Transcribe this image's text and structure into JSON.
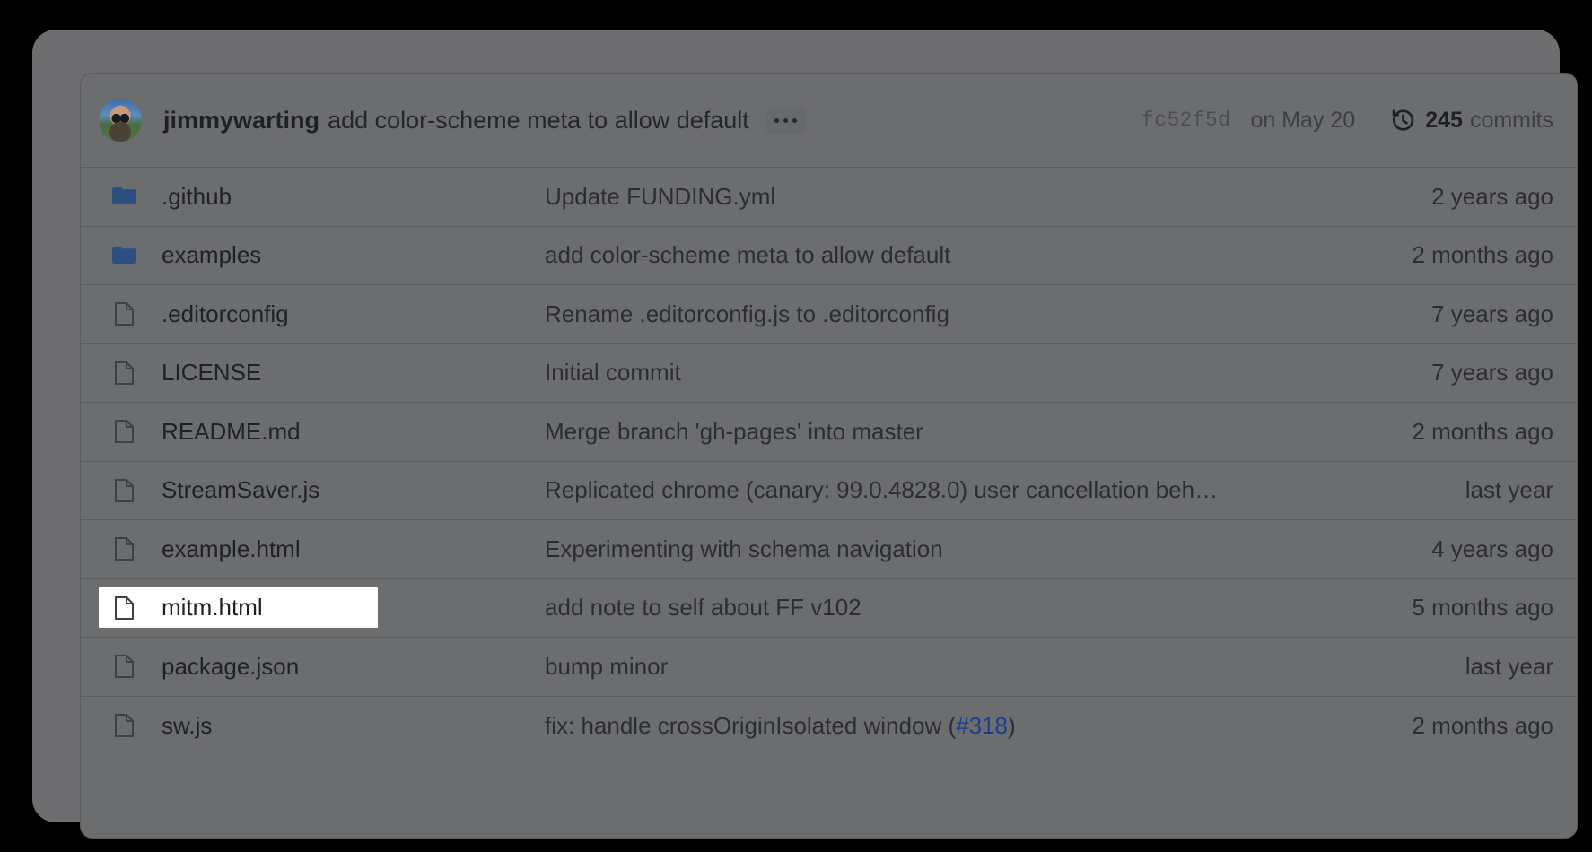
{
  "header": {
    "avatar_name": "jimmywarting-avatar",
    "author": "jimmywarting",
    "commit_message": "add color-scheme meta to allow default",
    "expand_label": "…",
    "commit_sha": "fc52f5d",
    "commit_date": "on May 20",
    "history_icon": "history-clock-icon",
    "commits_count": "245",
    "commits_word": "commits"
  },
  "files": [
    {
      "icon": "folder-icon",
      "type": "folder",
      "name": ".github",
      "message": "Update FUNDING.yml",
      "time": "2 years ago",
      "focused": false
    },
    {
      "icon": "folder-icon",
      "type": "folder",
      "name": "examples",
      "message": "add color-scheme meta to allow default",
      "time": "2 months ago",
      "focused": false
    },
    {
      "icon": "file-icon",
      "type": "file",
      "name": ".editorconfig",
      "message": "Rename .editorconfig.js to .editorconfig",
      "time": "7 years ago",
      "focused": false
    },
    {
      "icon": "file-icon",
      "type": "file",
      "name": "LICENSE",
      "message": "Initial commit",
      "time": "7 years ago",
      "focused": false
    },
    {
      "icon": "file-icon",
      "type": "file",
      "name": "README.md",
      "message": "Merge branch 'gh-pages' into master",
      "time": "2 months ago",
      "focused": false
    },
    {
      "icon": "file-icon",
      "type": "file",
      "name": "StreamSaver.js",
      "message": "Replicated chrome (canary: 99.0.4828.0) user cancellation beh…",
      "time": "last year",
      "focused": false
    },
    {
      "icon": "file-icon",
      "type": "file",
      "name": "example.html",
      "message": "Experimenting with schema navigation",
      "time": "4 years ago",
      "focused": false
    },
    {
      "icon": "file-icon",
      "type": "file",
      "name": "mitm.html",
      "message": "add note to self about FF v102",
      "time": "5 months ago",
      "focused": true
    },
    {
      "icon": "file-icon",
      "type": "file",
      "name": "package.json",
      "message": "bump minor",
      "time": "last year",
      "focused": false
    },
    {
      "icon": "file-icon",
      "type": "file",
      "name": "sw.js",
      "message": "fix: handle crossOriginIsolated window (",
      "message_link": "#318",
      "message_tail": ")",
      "time": "2 months ago",
      "focused": false
    }
  ],
  "colors": {
    "folder_blue": "#2b4f7e",
    "link_blue": "#1c3e91",
    "panel_bg": "#6c6d6f",
    "focus_bg": "#ffffff",
    "divider": "#5b5c5e"
  }
}
